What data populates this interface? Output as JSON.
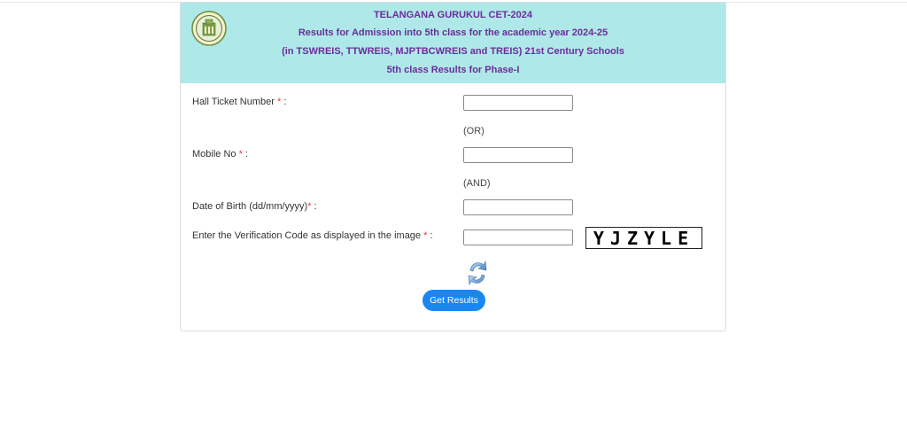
{
  "header": {
    "line1": "TELANGANA GURUKUL CET-2024",
    "line2": "Results for Admission into 5th class for the academic year 2024-25",
    "line3": "(in TSWREIS, TTWREIS, MJPTBCWREIS and TREIS) 21st Century Schools",
    "line4": "5th class Results for Phase-I",
    "title_color": "#6a2d9b",
    "background_color": "#afe8e8",
    "logo_icon": "telangana-emblem-icon"
  },
  "form": {
    "hall_ticket": {
      "label": "Hall Ticket Number",
      "required_mark": "*",
      "suffix": " :",
      "value": ""
    },
    "or_separator": "(OR)",
    "mobile": {
      "label": "Mobile No",
      "required_mark": "*",
      "suffix": " :",
      "value": ""
    },
    "and_separator": "(AND)",
    "dob": {
      "label": "Date of Birth (dd/mm/yyyy)",
      "required_mark": "*",
      "suffix": " :",
      "value": ""
    },
    "verification": {
      "label": "Enter the Verification Code as displayed in the image",
      "required_mark": "*",
      "suffix": " :",
      "value": ""
    },
    "captcha_text": "YJZYLE",
    "refresh_icon": "refresh-icon",
    "submit_label": "Get Results",
    "required_color": "#e53935",
    "button_color": "#1a86f3"
  }
}
